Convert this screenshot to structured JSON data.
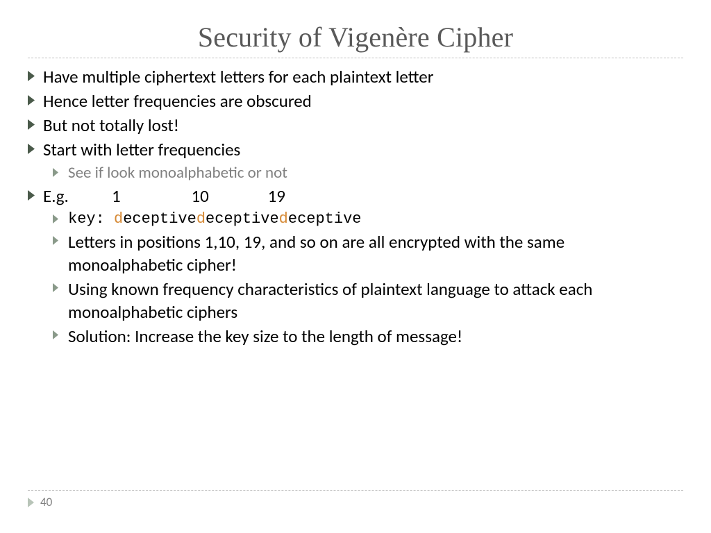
{
  "title": "Security of Vigenère Cipher",
  "bullets": {
    "b1": "Have multiple ciphertext letters for each plaintext letter",
    "b2": "Hence letter frequencies are obscured",
    "b3": "But not totally lost!",
    "b4": "Start with letter frequencies",
    "b4a": "See if look monoalphabetic or not",
    "b5_prefix": "E.g.",
    "b5_n1": "1",
    "b5_n2": "10",
    "b5_n3": "19",
    "b5a_label": "key:    ",
    "b5a_d": "d",
    "b5a_rest": "eceptive",
    "b5b": "Letters in positions 1,10, 19, and so on are all encrypted with the same monoalphabetic cipher!",
    "b5c": "Using known frequency characteristics of plaintext language to attack each monoalphabetic ciphers",
    "b5d": "Solution: Increase the key size to the length of message!"
  },
  "pagenum": "40",
  "colors": {
    "bullet_main": "#4a5a4a",
    "bullet_sub": "#8a9a8a"
  }
}
